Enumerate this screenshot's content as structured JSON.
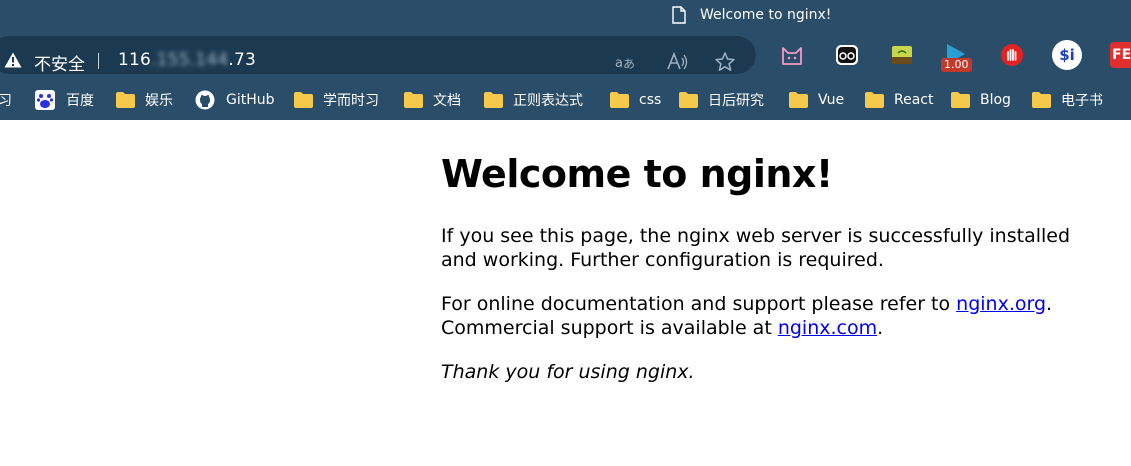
{
  "browser": {
    "tab": {
      "title": "Welcome to nginx!"
    },
    "address_bar": {
      "security_label": "不安全",
      "url_start": "116",
      "url_hidden": ".155.144",
      "url_end": ".73"
    },
    "extensions": {
      "rate_badge": "1.00",
      "si_label": "$i",
      "fe_label": "FE"
    },
    "bookmarks": [
      {
        "label": "习",
        "icon": "folder-icon"
      },
      {
        "label": "百度",
        "icon": "baidu-icon"
      },
      {
        "label": "娱乐",
        "icon": "folder-icon"
      },
      {
        "label": "GitHub",
        "icon": "github-icon"
      },
      {
        "label": "学而时习",
        "icon": "folder-icon"
      },
      {
        "label": "文档",
        "icon": "folder-icon"
      },
      {
        "label": "正则表达式",
        "icon": "folder-icon"
      },
      {
        "label": "css",
        "icon": "folder-icon"
      },
      {
        "label": "日后研究",
        "icon": "folder-icon"
      },
      {
        "label": "Vue",
        "icon": "folder-icon"
      },
      {
        "label": "React",
        "icon": "folder-icon"
      },
      {
        "label": "Blog",
        "icon": "folder-icon"
      },
      {
        "label": "电子书",
        "icon": "folder-icon"
      }
    ],
    "colors": {
      "chrome": "#2a4d69",
      "omnibox": "#1b3a52",
      "folder": "#f6c94a",
      "link": "#0000ee"
    }
  },
  "page": {
    "heading": "Welcome to nginx!",
    "para1": "If you see this page, the nginx web server is successfully installed and working. Further configuration is required.",
    "para2_text1": "For online documentation and support please refer to ",
    "para2_link1": "nginx.org",
    "para2_text2": ".",
    "para2_text3": "Commercial support is available at ",
    "para2_link2": "nginx.com",
    "para2_text4": ".",
    "para3": "Thank you for using nginx."
  }
}
